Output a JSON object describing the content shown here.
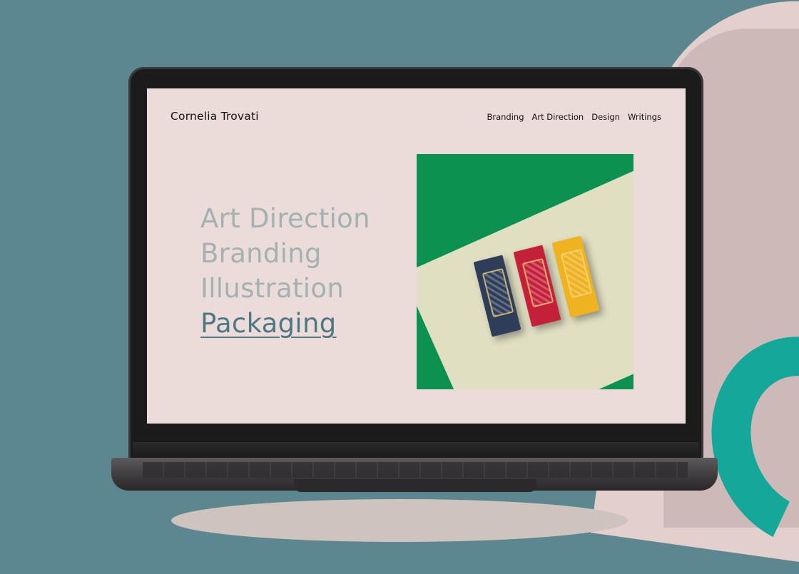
{
  "site": {
    "logo": "Cornelia Trovati",
    "nav": [
      "Branding",
      "Art Direction",
      "Design",
      "Writings"
    ]
  },
  "hero": {
    "services": [
      {
        "label": "Art Direction",
        "active": false
      },
      {
        "label": "Branding",
        "active": false
      },
      {
        "label": "Illustration",
        "active": false
      },
      {
        "label": "Packaging",
        "active": true
      }
    ],
    "image": "chocolate-bar-packaging-photo"
  },
  "colors": {
    "background": "#5c8790",
    "screen": "#ecdcd9",
    "service_inactive": "#a3b1b3",
    "service_active": "#4f7684",
    "photo_green": "#0c9150",
    "teal_shape": "#14a79a"
  }
}
